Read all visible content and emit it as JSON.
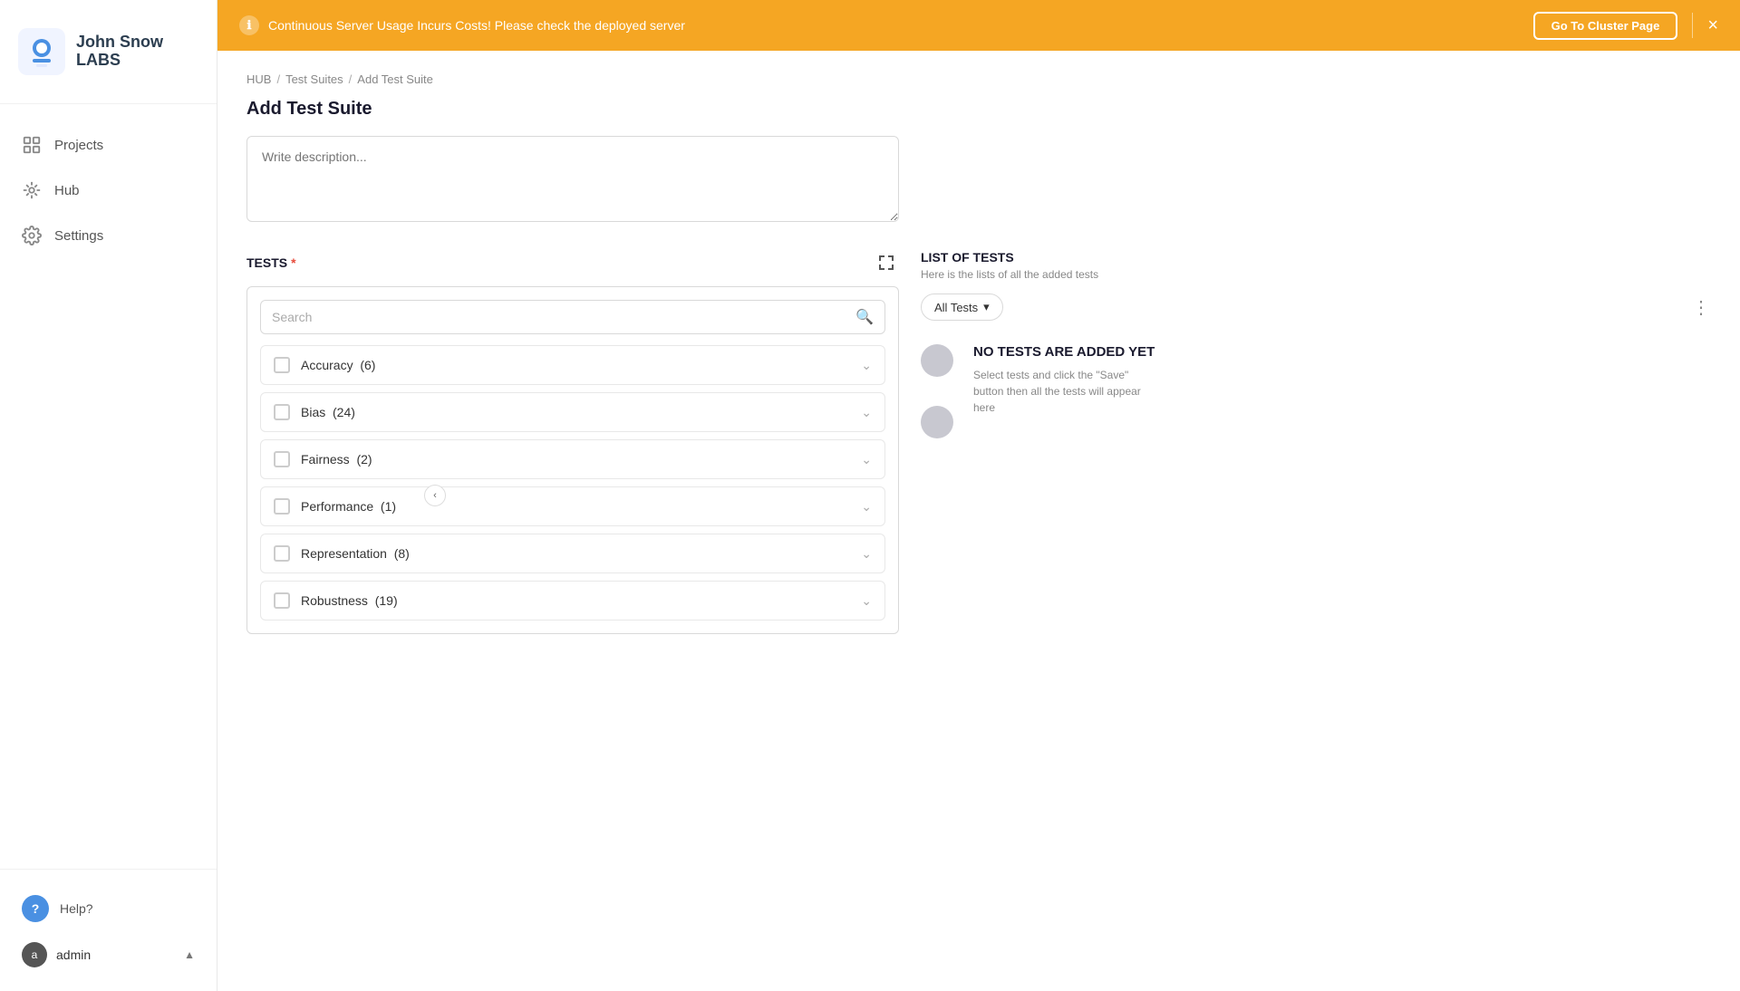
{
  "app": {
    "logo_line1": "John Snow",
    "logo_line2": "LABS"
  },
  "banner": {
    "message": "Continuous Server Usage Incurs Costs! Please check the deployed server",
    "info_icon": "ℹ",
    "cluster_btn": "Go To Cluster Page",
    "close_icon": "×"
  },
  "sidebar": {
    "nav_items": [
      {
        "id": "projects",
        "label": "Projects"
      },
      {
        "id": "hub",
        "label": "Hub"
      },
      {
        "id": "settings",
        "label": "Settings"
      }
    ],
    "help_label": "Help?",
    "admin_label": "admin",
    "admin_initial": "a"
  },
  "breadcrumb": {
    "hub": "HUB",
    "sep1": "/",
    "test_suites": "Test Suites",
    "sep2": "/",
    "current": "Add Test Suite"
  },
  "page": {
    "title": "Add Test Suite"
  },
  "description": {
    "placeholder": "Write description..."
  },
  "tests_section": {
    "label": "TESTS",
    "search_placeholder": "Search",
    "categories": [
      {
        "id": "accuracy",
        "name": "Accuracy",
        "count": 6
      },
      {
        "id": "bias",
        "name": "Bias",
        "count": 24
      },
      {
        "id": "fairness",
        "name": "Fairness",
        "count": 2
      },
      {
        "id": "performance",
        "name": "Performance",
        "count": 1
      },
      {
        "id": "representation",
        "name": "Representation",
        "count": 8
      },
      {
        "id": "robustness",
        "name": "Robustness",
        "count": 19
      }
    ]
  },
  "list_of_tests": {
    "title": "LIST OF TESTS",
    "subtitle": "Here is the lists of all the added tests",
    "filter_label": "All Tests",
    "no_tests_title": "NO TESTS ARE ADDED YET",
    "no_tests_desc": "Select tests and click the \"Save\" button then all the tests will appear here"
  },
  "colors": {
    "accent_orange": "#f5a623",
    "accent_blue": "#4a90e2"
  }
}
